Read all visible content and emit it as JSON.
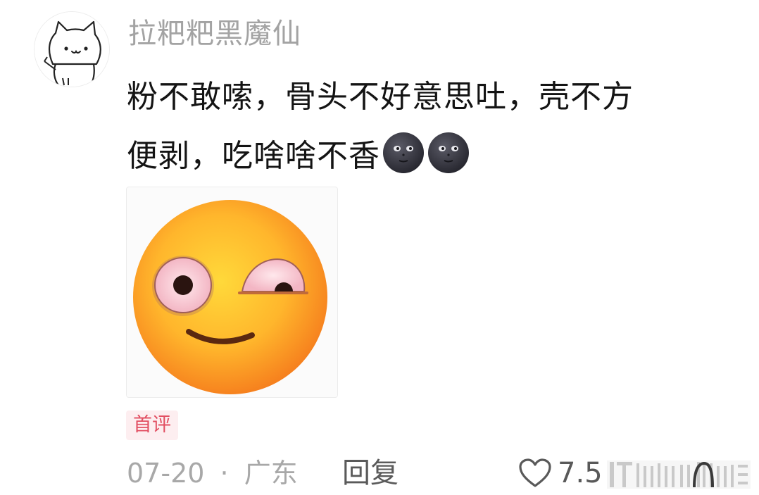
{
  "comment": {
    "username": "拉粑粑黑魔仙",
    "text_lines": [
      "粉不敢嗦，骨头不好意思吐，壳不方",
      "便剥，吃啥啥不香"
    ],
    "inline_emoji": [
      "new-moon-face",
      "new-moon-face"
    ],
    "image": "flushed-side-eye-emoji",
    "badge": "首评",
    "date": "07-20",
    "separator": "·",
    "location": "广东",
    "reply_label": "回复",
    "like_count": "7.5"
  },
  "colors": {
    "username": "#a3a3a3",
    "text": "#141414",
    "badge_bg": "#fdeef0",
    "badge_text": "#e24f62",
    "meta": "#a8a8a8"
  }
}
